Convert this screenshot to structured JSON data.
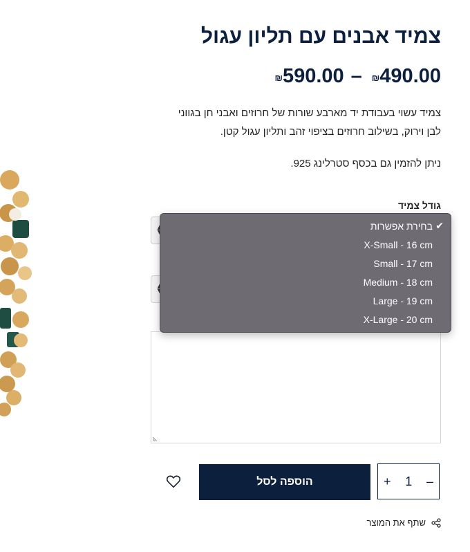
{
  "product": {
    "title": "צמיד אבנים עם תליון עגול",
    "price_min": "490.00",
    "price_max": "590.00",
    "currency": "₪",
    "dash": "–",
    "description": "צמיד עשוי בעבודת יד מארבע שורות של חרוזים ואבני חן בגווני לבן וירוק, בשילוב חרוזים בציפוי זהב ותליון עגול קטן.",
    "description_note": "ניתן להזמין גם בכסף סטרלינג 925."
  },
  "size_select": {
    "label": "גודל צמיד",
    "options": [
      {
        "label": "בחירת אפשרות",
        "selected": true
      },
      {
        "label": "X-Small - 16 cm",
        "selected": false
      },
      {
        "label": "Small - 17 cm",
        "selected": false
      },
      {
        "label": "Medium - 18 cm",
        "selected": false
      },
      {
        "label": "Large - 19 cm",
        "selected": false
      },
      {
        "label": "X-Large - 20 cm",
        "selected": false
      }
    ]
  },
  "cart": {
    "quantity": "1",
    "minus": "–",
    "plus": "+",
    "add_to_cart_label": "הוספה לסל"
  },
  "share": {
    "label": "שתף את המוצר"
  },
  "colors": {
    "navy": "#0c1f3d",
    "dropdown_bg": "#6e6b73"
  },
  "icons": {
    "wishlist": "heart-icon",
    "share": "share-icon",
    "check": "checkmark-icon"
  }
}
